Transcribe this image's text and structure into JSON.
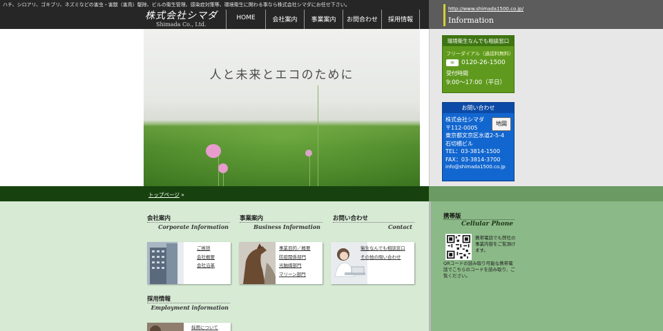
{
  "header": {
    "tagline": "ハチ、シロアリ、ゴキブリ、ネズミなどの害虫・害獣（害鳥）駆除、ビルの衛生管理、感染症対策等、環境衛生に関わる事なら株式会社シマダにお任せ下さい。",
    "logo_ja": "株式会社シマダ",
    "logo_en": "Shimada Co., Ltd.",
    "nav": [
      {
        "label": "HOME"
      },
      {
        "label": "会社案内"
      },
      {
        "label": "事業案内"
      },
      {
        "label": "お問合わせ"
      },
      {
        "label": "採用情報"
      }
    ]
  },
  "info": {
    "url": "http://www.shimada1500.co.jp/",
    "title": "Information",
    "consult": {
      "title": "環境衛生なんでも相談窓口",
      "sub": "フリーダイアル（通話料無料）",
      "tel": "0120-26-1500",
      "hours_label": "受付時間",
      "hours": "9:00～17:00（平日）"
    },
    "contact": {
      "title": "お問い合わせ",
      "map_label": "地図",
      "company": "株式会社シマダ",
      "postal": "〒112-0005",
      "addr1": "東京都文京区水道2-5-4",
      "addr2": "石切橋ビル",
      "tel": "TEL：03-3814-1500",
      "fax": "FAX：03-3814-3700",
      "email": "info@shimada1500.co.jp"
    }
  },
  "hero": {
    "tagline": "人と未来とエコのために"
  },
  "breadcrumb": {
    "home": "トップページ",
    "sep": "»"
  },
  "sections": {
    "company": {
      "title": "会社案内",
      "en": "Corporate Information",
      "links": [
        "ご挨拶",
        "会社概要",
        "会社沿革"
      ]
    },
    "business": {
      "title": "事業案内",
      "en": "Business Information",
      "links": [
        "事業目的／概要",
        "防疫関係部門",
        "光触媒部門",
        "マリーン部門"
      ]
    },
    "contact": {
      "title": "お問い合わせ",
      "en": "Contact",
      "links": [
        "衛生なんでも相談窓口",
        "その他の問い合わせ"
      ]
    },
    "employment": {
      "title": "採用情報",
      "en": "Employment information",
      "links": [
        "採用について"
      ]
    }
  },
  "mobile": {
    "title": "携帯版",
    "en": "Cellular Phone",
    "text1": "携帯電話でも弊社の事業内容をご覧頂けます。",
    "text2": "QRコードの読み取り可能な携帯電話でこちらのコードを読み取り、ご覧ください。"
  },
  "colors": {
    "header_bg": "#262626",
    "green_box": "#5f9a1e",
    "blue_box": "#1266cf",
    "breadcrumb_bg": "#17420f",
    "content_bg": "#d6ead4",
    "sidebar_bg": "#8bb987"
  }
}
